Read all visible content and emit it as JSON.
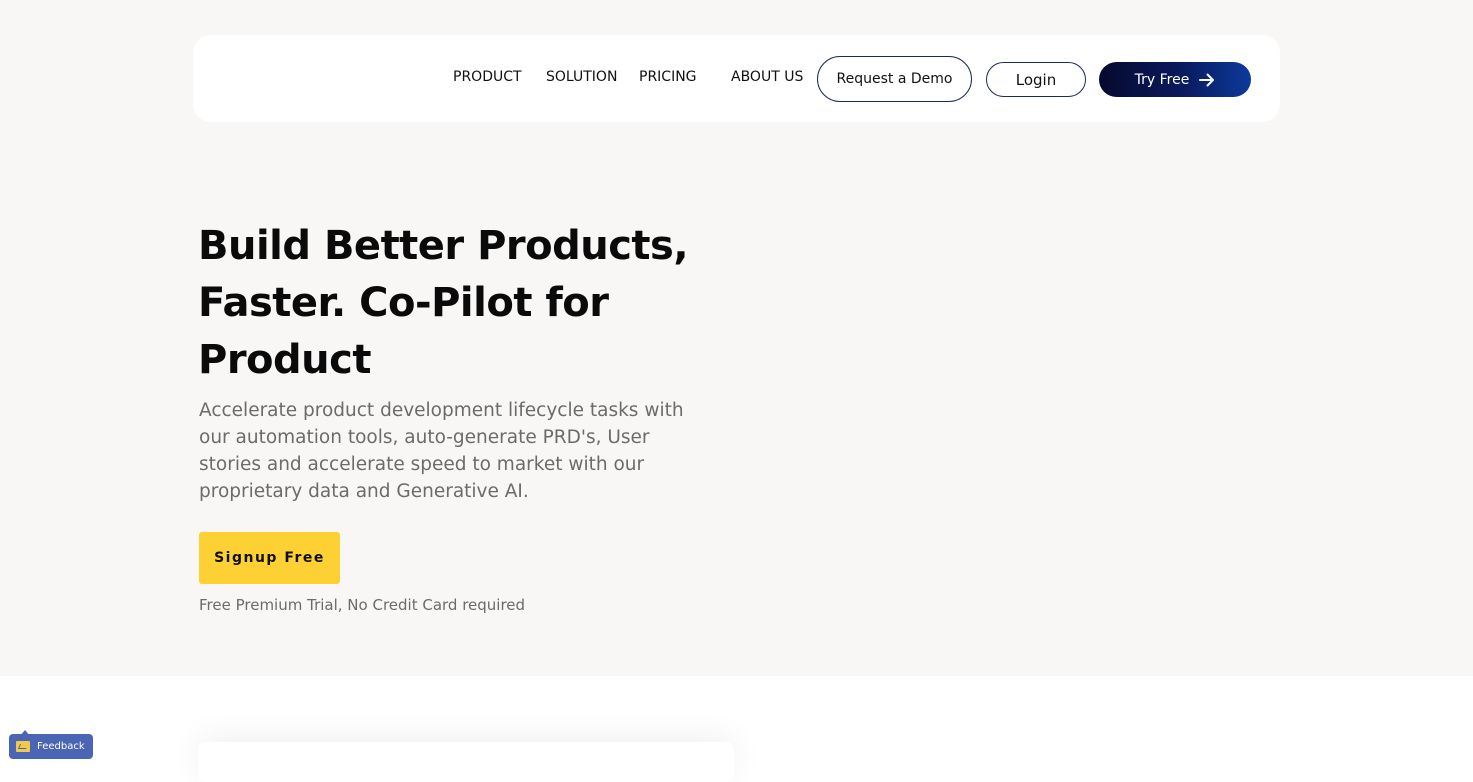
{
  "nav": {
    "links": [
      "PRODUCT",
      "SOLUTION",
      "PRICING",
      "ABOUT US"
    ],
    "request_demo_label": "Request a Demo",
    "login_label": "Login",
    "try_free_label": "Try Free",
    "try_free_icon": "arrow-right-icon"
  },
  "hero": {
    "title": "Build Better Products, Faster. Co-Pilot for Product",
    "subtitle": "Accelerate product development lifecycle tasks with our automation tools, auto-generate PRD's, User stories and accelerate speed to market with our proprietary data and Generative AI.",
    "signup_label": "Signup Free",
    "trial_note": "Free Premium Trial, No Credit Card required"
  },
  "feedback": {
    "label": "Feedback",
    "icon": "feedback-icon"
  },
  "colors": {
    "hero_bg": "#f8f7f6",
    "primary_dark": "#070a2e",
    "primary_blue": "#0b3a9a",
    "accent_yellow": "#fdd033",
    "feedback_blue": "#4a65b4"
  }
}
